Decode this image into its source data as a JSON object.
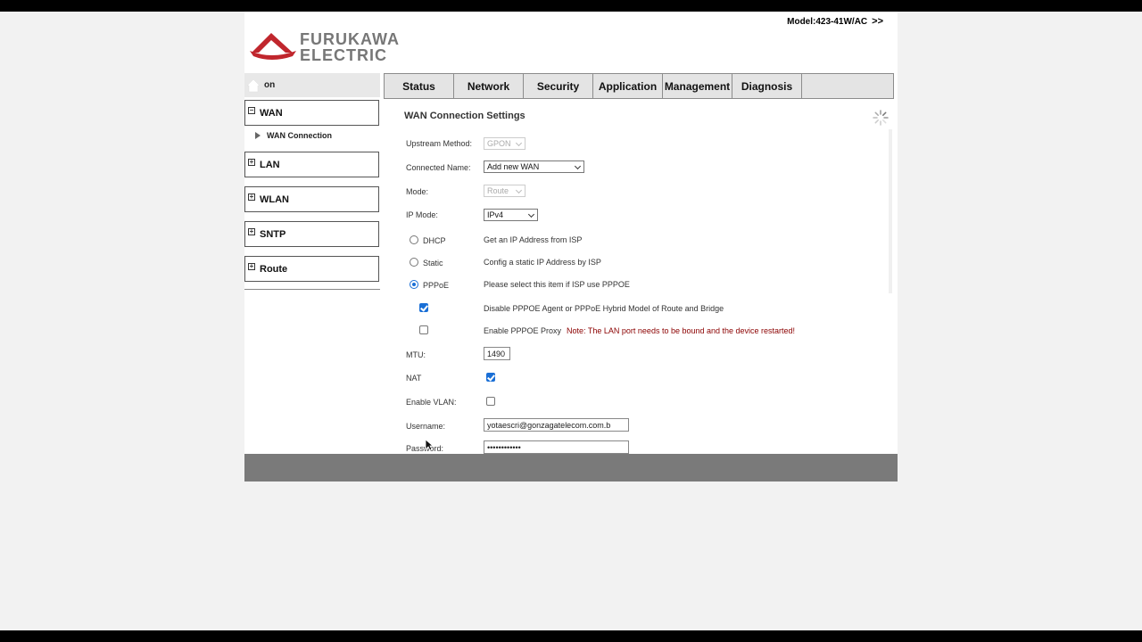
{
  "header": {
    "brand_line1": "FURUKAWA",
    "brand_line2": "ELECTRIC",
    "model": "Model:423-41W/AC",
    "model_arrow": ">>",
    "logo_color": "#c0262d"
  },
  "nav": {
    "tabs": [
      "Status",
      "Network",
      "Security",
      "Application",
      "Management",
      "Diagnosis"
    ]
  },
  "sidebar": {
    "header_label": "on",
    "groups": [
      {
        "label": "WAN",
        "icon": "minus-box-icon"
      },
      {
        "label": "LAN",
        "icon": "plus-box-icon"
      },
      {
        "label": "WLAN",
        "icon": "plus-box-icon"
      },
      {
        "label": "SNTP",
        "icon": "plus-box-icon"
      },
      {
        "label": "Route",
        "icon": "plus-box-icon"
      }
    ],
    "sub_item": "WAN Connection"
  },
  "form": {
    "title": "WAN Connection Settings",
    "upstream_label": "Upstream Method:",
    "upstream_value": "GPON",
    "connected_name_label": "Connected Name:",
    "connected_name_value": "Add new WAN",
    "mode_label": "Mode:",
    "mode_value": "Route",
    "ip_mode_label": "IP Mode:",
    "ip_mode_value": "IPv4",
    "dhcp_label": "DHCP",
    "dhcp_desc": "Get an IP Address from ISP",
    "static_label": "Static",
    "static_desc": "Config a static IP Address by ISP",
    "pppoe_label": "PPPoE",
    "pppoe_desc": "Please select this item if ISP use PPPOE",
    "disable_agent_desc": "Disable PPPOE Agent or PPPoE Hybrid Model of Route and Bridge",
    "enable_proxy_desc": "Enable PPPOE Proxy",
    "proxy_note": "Note: The LAN port needs to be bound and the device restarted!",
    "mtu_label": "MTU:",
    "mtu_value": "1490",
    "nat_label": "NAT",
    "vlan_label": "Enable VLAN:",
    "username_label": "Username:",
    "username_value": "yotaescri@gonzagatelecom.com.b",
    "password_label": "Password:",
    "password_value": "••••••••••••",
    "checked": {
      "pppoe": true,
      "disable_agent": true,
      "enable_proxy": false,
      "nat": true,
      "vlan": false
    }
  },
  "colors": {
    "accent": "#1a6fd6",
    "note": "#8b0000",
    "footer": "#7a7a7a"
  }
}
